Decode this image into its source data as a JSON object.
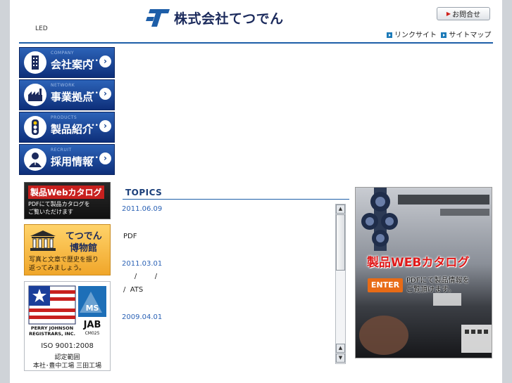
{
  "header": {
    "led_label": "LED",
    "company_name": "株式会社てつでん",
    "inquiry_label": "お問合せ",
    "link_site": "リンクサイト",
    "site_map": "サイトマップ"
  },
  "nav": [
    {
      "en": "COMPANY",
      "label": "会社案内"
    },
    {
      "en": "NETWORK",
      "label": "事業拠点"
    },
    {
      "en": "PRODUCTS",
      "label": "製品紹介"
    },
    {
      "en": "RECRUIT",
      "label": "採用情報"
    }
  ],
  "catalog_banner": {
    "title": "製品Webカタログ",
    "line1": "PDFにて製品カタログを",
    "line2": "ご覧いただけます"
  },
  "museum_banner": {
    "title1": "てつでん",
    "title2": "博物館",
    "line1": "写真と文章で歴史を振り",
    "line2": "返ってみましょう。"
  },
  "certification": {
    "org1": "PERRY JOHNSON",
    "org2": "REGISTRARS, INC.",
    "ms": "MS",
    "jab": "JAB",
    "code": "CM025",
    "standard": "ISO 9001:2008",
    "scope": "認定範囲",
    "sites": "本社･豊中工場 三田工場"
  },
  "topics": {
    "title": "TOPICS",
    "items": [
      {
        "date": "2011.06.09",
        "text": "PDF"
      },
      {
        "date": "2011.03.01",
        "text1": "     /        /",
        "text2": "/  ATS"
      },
      {
        "date": "2009.04.01"
      }
    ]
  },
  "web_catalog": {
    "title": "製品WEBカタログ",
    "enter": "ENTER",
    "desc1": "PDFにて製品情報を",
    "desc2": "ご覧頂けます。"
  },
  "colors": {
    "brand_blue": "#1d5ea8",
    "nav_blue": "#12408f",
    "accent_red": "#d0201a",
    "date_blue": "#2b62b5"
  }
}
